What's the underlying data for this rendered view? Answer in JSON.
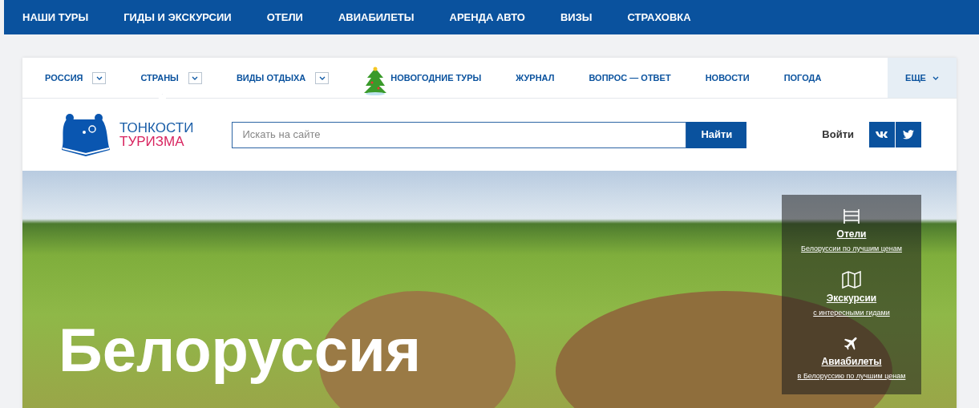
{
  "top_nav": [
    "НАШИ ТУРЫ",
    "ГИДЫ И ЭКСКУРСИИ",
    "ОТЕЛИ",
    "АВИАБИЛЕТЫ",
    "АРЕНДА АВТО",
    "ВИЗЫ",
    "СТРАХОВКА"
  ],
  "menu": [
    {
      "label": "РОССИЯ",
      "kind": "dropdown",
      "selected": false
    },
    {
      "label": "СТРАНЫ",
      "kind": "dropdown",
      "selected": true
    },
    {
      "label": "ВИДЫ ОТДЫХА",
      "kind": "dropdown",
      "selected": false
    },
    {
      "label": "НОВОГОДНИЕ ТУРЫ",
      "kind": "holiday",
      "selected": false
    },
    {
      "label": "ЖУРНАЛ",
      "kind": "link",
      "selected": false
    },
    {
      "label": "ВОПРОС — ОТВЕТ",
      "kind": "link",
      "selected": false
    },
    {
      "label": "НОВОСТИ",
      "kind": "link",
      "selected": false
    },
    {
      "label": "ПОГОДА",
      "kind": "link",
      "selected": false
    }
  ],
  "more": "ЕЩЕ",
  "logo": {
    "line1": "ТОНКОСТИ",
    "line2": "ТУРИЗМА"
  },
  "search": {
    "placeholder": "Искать на сайте",
    "button": "Найти"
  },
  "login": "Войти",
  "hero": {
    "title": "Белоруссия",
    "cards": [
      {
        "kind": "bed",
        "title": "Отели",
        "subtitle": "Белоруссии по лучшим ценам"
      },
      {
        "kind": "map",
        "title": "Экскурсии",
        "subtitle": "с интересными гидами"
      },
      {
        "kind": "plane",
        "title": "Авиабилеты",
        "subtitle": "в Белоруссию по лучшим ценам"
      }
    ]
  }
}
